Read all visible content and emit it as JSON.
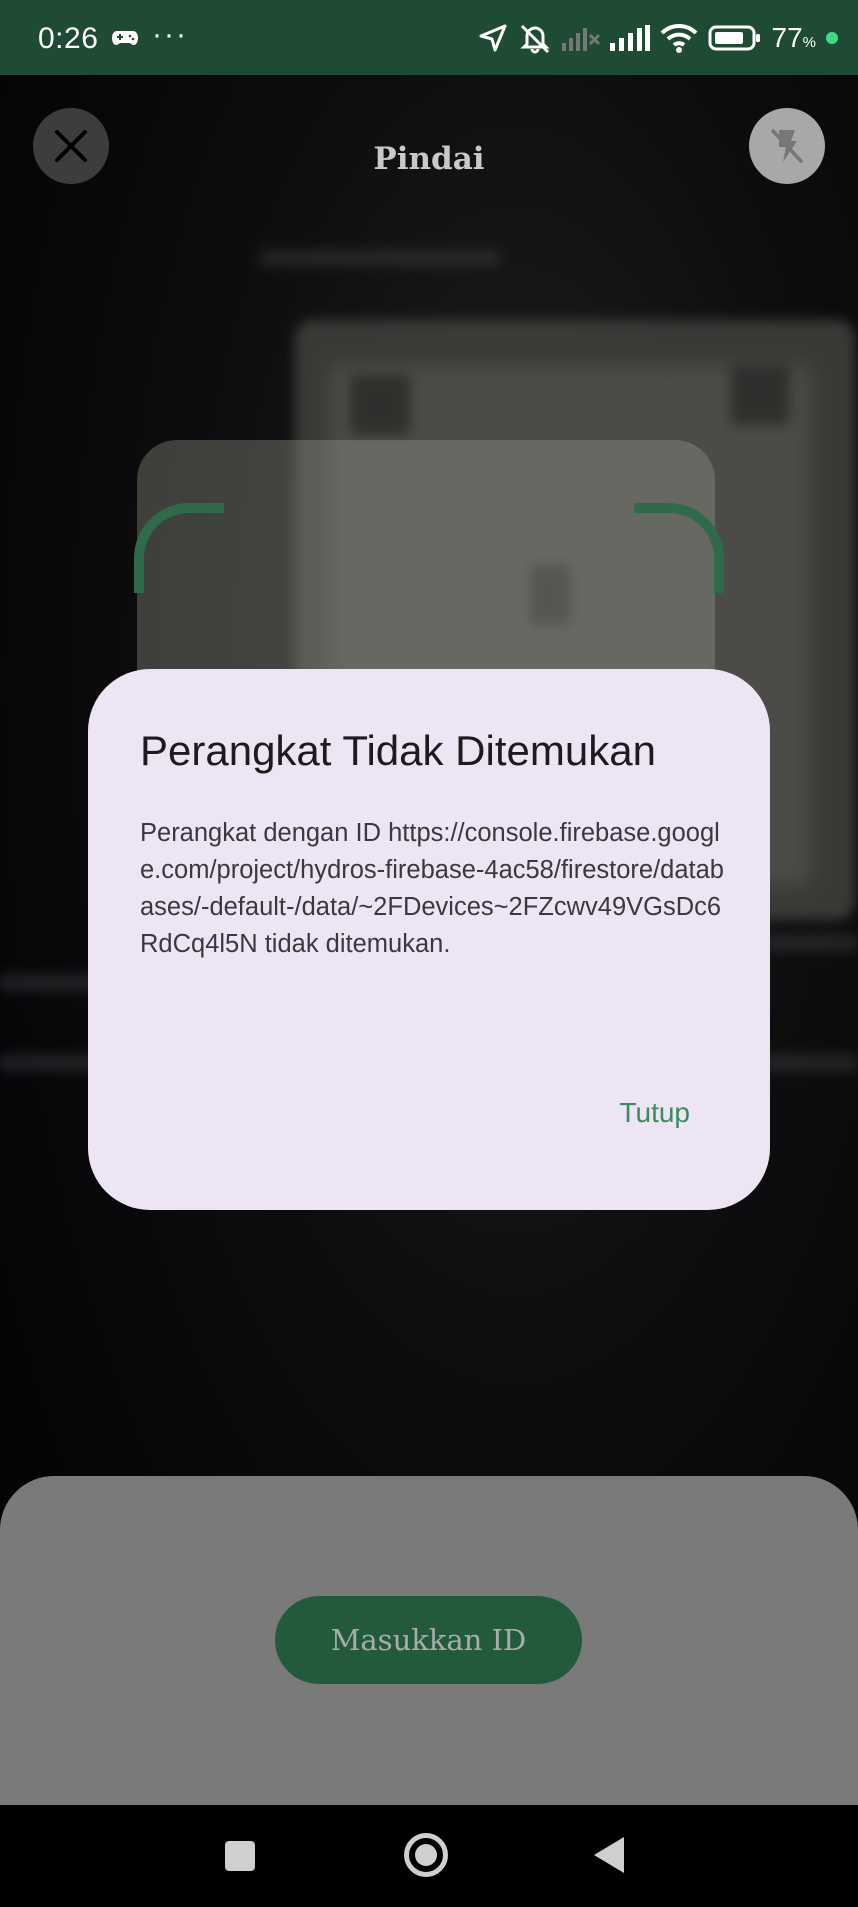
{
  "status_bar": {
    "time": "0:26",
    "more": "···",
    "battery_level": "77",
    "battery_unit": "%",
    "icons": [
      "gamepad-icon",
      "location-arrow-icon",
      "mute-icon",
      "mobile-signal-off-icon",
      "signal-icon",
      "wifi-icon",
      "battery-icon",
      "charging-dot-icon"
    ]
  },
  "header": {
    "title": "Pindai",
    "close_icon": "close-icon",
    "flash_icon": "flash-off-icon"
  },
  "dialog": {
    "title": "Perangkat Tidak Ditemukan",
    "message": "Perangkat dengan ID https://console.firebase.google.com/project/hydros-firebase-4ac58/firestore/databases/-default-/data/~2FDevices~2FZcwv49VGsDc6RdCq4l5N tidak ditemukan.",
    "action": "Tutup"
  },
  "bottom_sheet": {
    "manual_button": "Masukkan ID"
  },
  "nav_bar": {
    "icons": [
      "recents-icon",
      "home-icon",
      "back-icon"
    ]
  },
  "colors": {
    "status_bar": "#1f4a33",
    "accent": "#3c8a5e",
    "dialog_bg": "#ede5f3",
    "button_bg": "#245a3c"
  }
}
